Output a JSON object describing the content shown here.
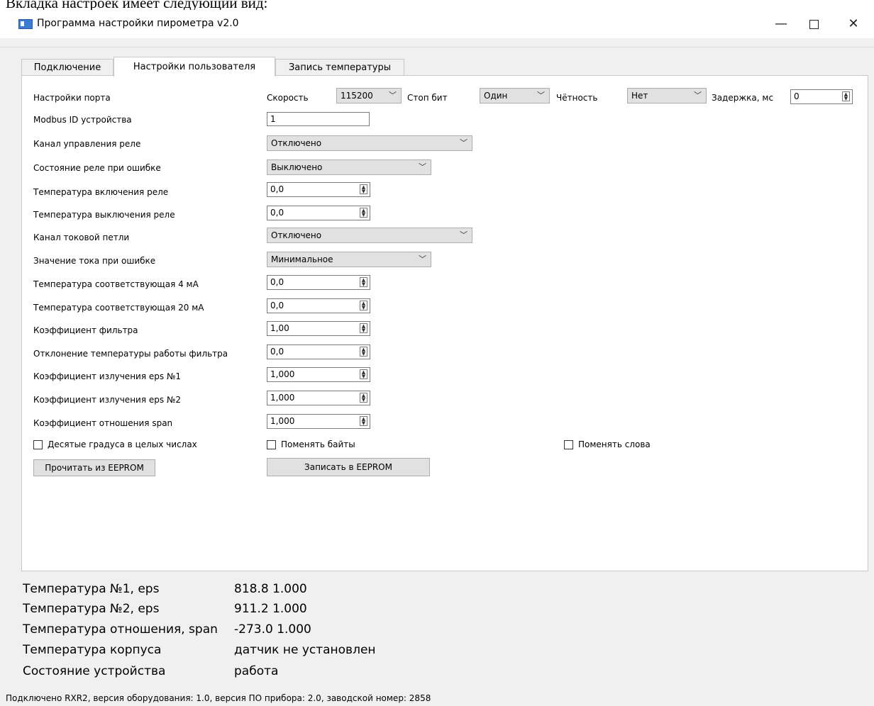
{
  "doc_heading": "Вкладка настроек имеет следующий вид:",
  "window": {
    "title": "Программа настройки пирометра v2.0",
    "minimize": "—",
    "close": "✕"
  },
  "tabs": [
    {
      "label": "Подключение",
      "active": false
    },
    {
      "label": "Настройки пользователя",
      "active": true
    },
    {
      "label": "Запись температуры",
      "active": false
    }
  ],
  "port": {
    "label": "Настройки порта",
    "speed_label": "Скорость",
    "speed_value": "115200",
    "stop_label": "Стоп бит",
    "stop_value": "Один",
    "parity_label": "Чётность",
    "parity_value": "Нет",
    "delay_label": "Задержка, мс",
    "delay_value": "0"
  },
  "fields": {
    "modbus_id": {
      "label": "Modbus ID устройства",
      "value": "1"
    },
    "relay_channel": {
      "label": "Канал управления реле",
      "value": "Отключено"
    },
    "relay_error_state": {
      "label": "Состояние реле при ошибке",
      "value": "Выключено"
    },
    "relay_on_temp": {
      "label": "Температура включения реле",
      "value": "0,0"
    },
    "relay_off_temp": {
      "label": "Температура выключения реле",
      "value": "0,0"
    },
    "current_loop_channel": {
      "label": "Канал токовой петли",
      "value": "Отключено"
    },
    "current_error_value": {
      "label": "Значение тока при ошибке",
      "value": "Минимальное"
    },
    "temp_4ma": {
      "label": "Температура соответствующая 4 мА",
      "value": "0,0"
    },
    "temp_20ma": {
      "label": "Температура соответствующая 20 мА",
      "value": "0,0"
    },
    "filter_coef": {
      "label": "Коэффициент фильтра",
      "value": "1,00"
    },
    "filter_deviation": {
      "label": "Отклонение температуры работы фильтра",
      "value": "0,0"
    },
    "eps1": {
      "label": "Коэффициент излучения eps №1",
      "value": "1,000"
    },
    "eps2": {
      "label": "Коэффициент излучения eps №2",
      "value": "1,000"
    },
    "span": {
      "label": "Коэффициент отношения span",
      "value": "1,000"
    }
  },
  "checkboxes": {
    "tenths": "Десятые градуса в целых числах",
    "swap_bytes": "Поменять байты",
    "swap_words": "Поменять слова"
  },
  "buttons": {
    "read": "Прочитать из EEPROM",
    "write": "Записать в EEPROM"
  },
  "status": [
    {
      "label": "Температура №1, eps",
      "value": "818.8 1.000"
    },
    {
      "label": "Температура №2, eps",
      "value": "911.2 1.000"
    },
    {
      "label": "Температура отношения, span",
      "value": "-273.0 1.000"
    },
    {
      "label": "Температура корпуса",
      "value": "датчик не установлен"
    },
    {
      "label": "Состояние устройства",
      "value": "работа"
    }
  ],
  "footer": "Подключено RXR2, версия оборудования: 1.0, версия ПО прибора: 2.0, заводской номер: 2858"
}
